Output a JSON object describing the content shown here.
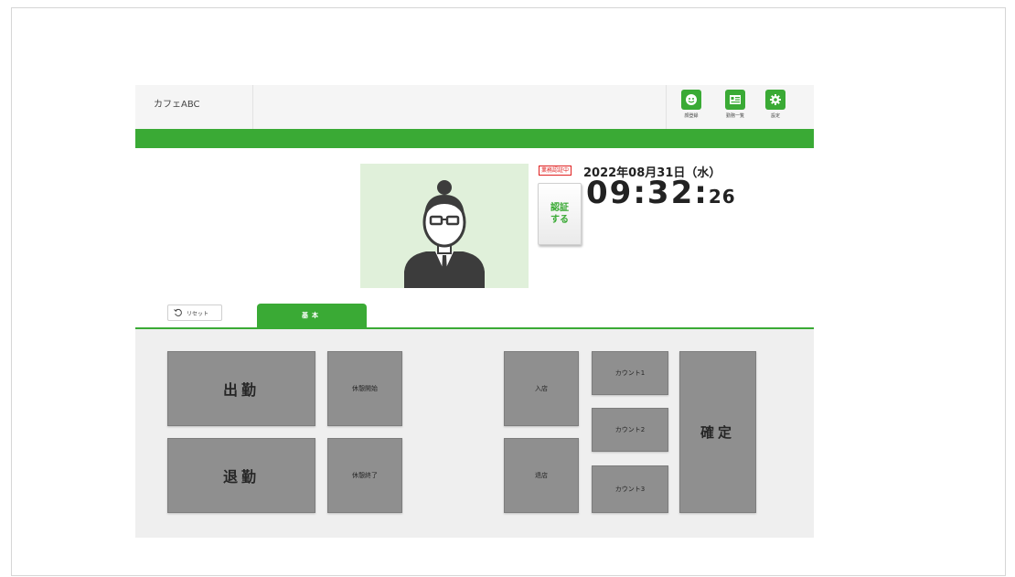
{
  "header": {
    "store_name": "カフェABC",
    "buttons": [
      {
        "label": "顔登録",
        "icon": "face-icon"
      },
      {
        "label": "勤務一覧",
        "icon": "list-card-icon"
      },
      {
        "label": "設定",
        "icon": "gear-icon"
      }
    ]
  },
  "status": {
    "auth_badge": "業務認証中",
    "date": "2022年08月31日（水）",
    "time_hm": "09:32:",
    "time_s": "26",
    "auth_button_label": "認証する"
  },
  "tabs": {
    "reset_label": "リセット",
    "basic_label": "基本"
  },
  "actions": {
    "clock_in": "出勤",
    "clock_out": "退勤",
    "break_start": "休憩開始",
    "break_end": "休憩終了",
    "enter_store": "入店",
    "leave_store": "退店",
    "count1": "カウント1",
    "count2": "カウント2",
    "count3": "カウント3",
    "confirm": "確定"
  },
  "colors": {
    "accent": "#3aaa35",
    "tile": "#8f8f8f",
    "photo_bg": "#e0f0da",
    "badge": "#e02020"
  }
}
